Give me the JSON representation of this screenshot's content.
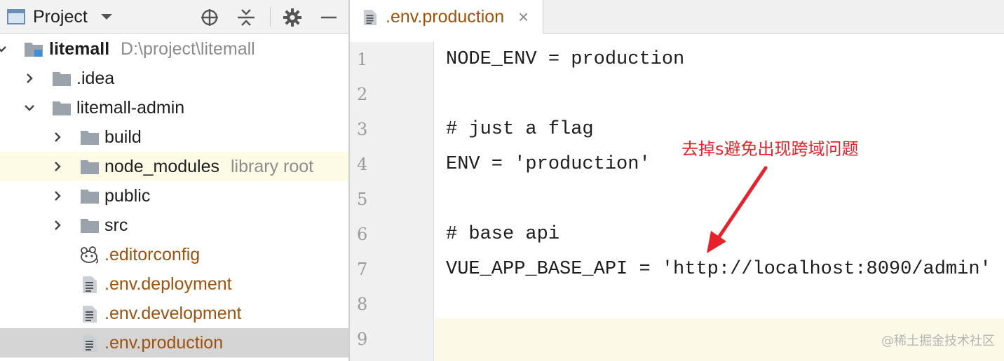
{
  "project_panel": {
    "title": "Project",
    "toolbar_icons": [
      "locate-icon",
      "collapse-icon",
      "gear-icon",
      "minimize-icon"
    ]
  },
  "tree": {
    "root": {
      "name": "litemall",
      "path": "D:\\project\\litemall"
    },
    "idea": ".idea",
    "admin": "litemall-admin",
    "build": "build",
    "node_modules": {
      "name": "node_modules",
      "hint": "library root"
    },
    "public": "public",
    "src": "src",
    "editorconfig": ".editorconfig",
    "env_deployment": ".env.deployment",
    "env_development": ".env.development",
    "env_production": ".env.production"
  },
  "editor": {
    "tab": {
      "label": ".env.production",
      "close": "×"
    },
    "line_numbers": [
      "1",
      "2",
      "3",
      "4",
      "5",
      "6",
      "7",
      "8",
      "9"
    ],
    "lines": [
      "NODE_ENV = production",
      "",
      "# just a flag",
      "ENV = 'production'",
      "",
      "# base api",
      "VUE_APP_BASE_API = 'http://localhost:8090/admin'",
      "",
      ""
    ],
    "current_line": "9"
  },
  "annotation": {
    "text": "去掉s避免出现跨域问题",
    "color": "#e8222a"
  },
  "watermark": "@稀土掘金技术社区",
  "colors": {
    "file_name_modified": "#a0520a",
    "library_row_bg": "#fdfbe6",
    "selected_row_bg": "#d5d5d5",
    "folder": "#9aa3ab"
  }
}
